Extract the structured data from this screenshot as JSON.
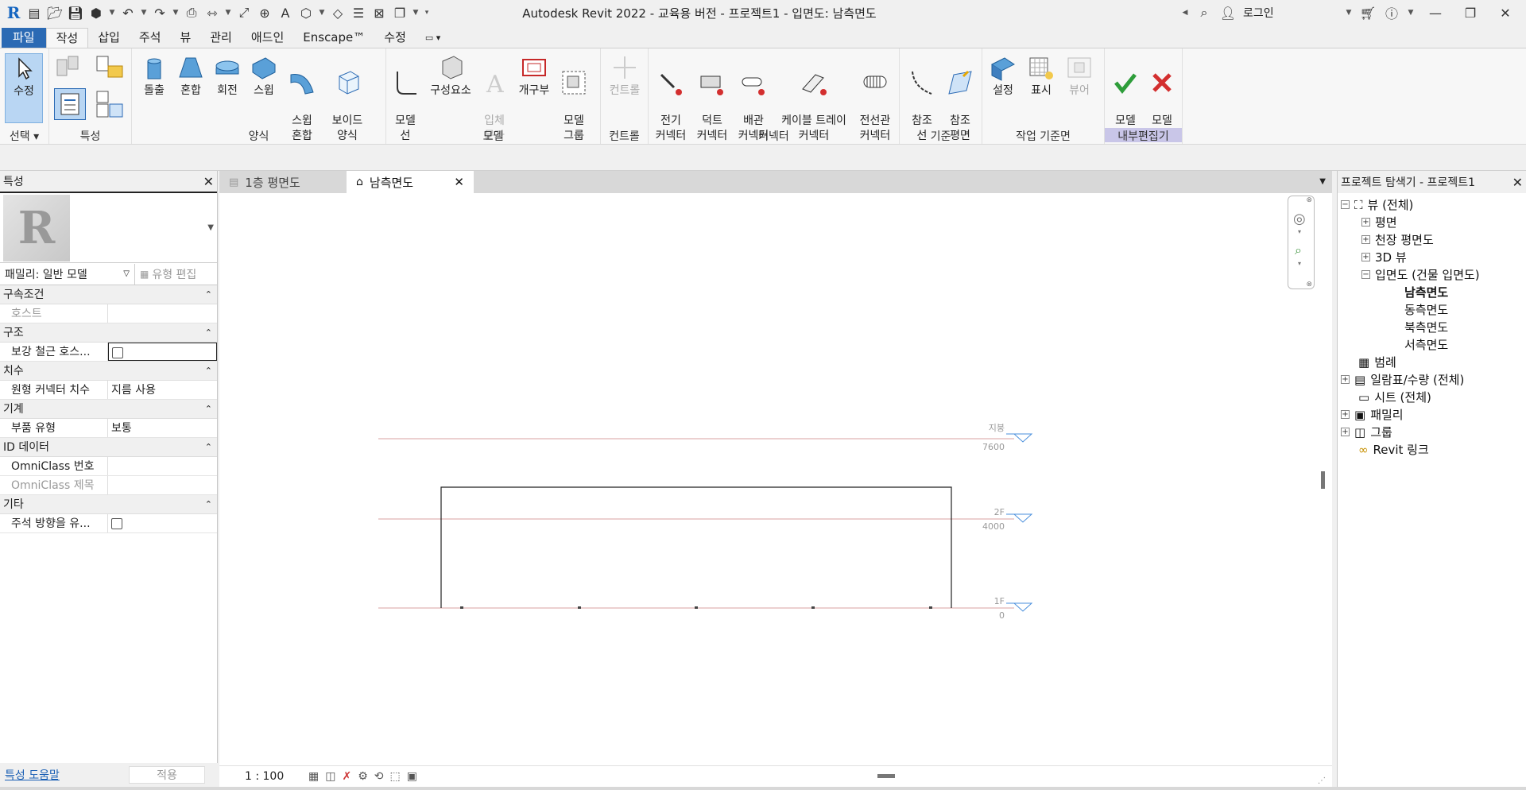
{
  "title": "Autodesk Revit 2022 - 교육용 버전 - 프로젝트1 - 입면도: 남측면도",
  "login": "로그인",
  "tabs": [
    "파일",
    "작성",
    "삽입",
    "주석",
    "뷰",
    "관리",
    "애드인",
    "Enscape™",
    "수정"
  ],
  "active_tab": "작성",
  "ribbon": {
    "select": {
      "button": "수정",
      "label": "선택"
    },
    "properties_label": "특성",
    "form": {
      "label": "양식",
      "buttons": [
        "돌출",
        "혼합",
        "회전",
        "스윕",
        "스윕\n혼합",
        "보이드\n양식"
      ]
    },
    "model": {
      "label": "모델",
      "buttons": [
        "모델\n선",
        "구성요소",
        "입체\n문자",
        "개구부",
        "모델\n그룹"
      ]
    },
    "control": {
      "label": "컨트롤",
      "buttons": [
        "컨트롤"
      ]
    },
    "connector": {
      "label": "커넥터",
      "buttons": [
        "전기\n커넥터",
        "덕트\n커넥터",
        "배관\n커넥터",
        "케이블 트레이\n커넥터",
        "전선관\n커넥터"
      ]
    },
    "datum": {
      "label": "기준",
      "buttons": [
        "참조\n선",
        "참조\n평면"
      ]
    },
    "workplane": {
      "label": "작업 기준면",
      "buttons": [
        "설정",
        "표시",
        "뷰어"
      ]
    },
    "inplace": {
      "label": "내부편집기",
      "buttons": [
        "모델\n완료",
        "모델\n취소"
      ]
    }
  },
  "properties": {
    "title": "특성",
    "family": "패밀리: 일반 모델",
    "edit_type": "유형 편집",
    "groups": [
      {
        "name": "구속조건",
        "rows": [
          {
            "k": "호스트",
            "v": "",
            "muted": true
          }
        ]
      },
      {
        "name": "구조",
        "rows": [
          {
            "k": "보강 철근 호스...",
            "v": "checkbox"
          }
        ]
      },
      {
        "name": "치수",
        "rows": [
          {
            "k": "원형 커넥터 치수",
            "v": "지름 사용"
          }
        ]
      },
      {
        "name": "기계",
        "rows": [
          {
            "k": "부품 유형",
            "v": "보통"
          }
        ]
      },
      {
        "name": "ID 데이터",
        "rows": [
          {
            "k": "OmniClass 번호",
            "v": ""
          },
          {
            "k": "OmniClass 제목",
            "v": "",
            "muted": true
          }
        ]
      },
      {
        "name": "기타",
        "rows": [
          {
            "k": "주석 방향을 유...",
            "v": "checkbox"
          }
        ]
      }
    ],
    "help_link": "특성 도움말",
    "apply": "적용"
  },
  "view_tabs": [
    {
      "label": "1층 평면도",
      "active": false
    },
    {
      "label": "남측면도",
      "active": true
    }
  ],
  "levels": [
    {
      "name": "지붕",
      "elev": "7600"
    },
    {
      "name": "2F",
      "elev": "4000"
    },
    {
      "name": "1F",
      "elev": "0"
    }
  ],
  "scale": "1 : 100",
  "browser": {
    "title": "프로젝트 탐색기 - 프로젝트1",
    "nodes": {
      "views": "뷰 (전체)",
      "plans": "평면",
      "ceiling": "천장 평면도",
      "threed": "3D 뷰",
      "elevations": "입면도 (건물 입면도)",
      "south": "남측면도",
      "east": "동측면도",
      "north": "북측면도",
      "west": "서측면도",
      "legend": "범례",
      "schedules": "일람표/수량 (전체)",
      "sheets": "시트 (전체)",
      "families": "패밀리",
      "groups": "그룹",
      "links": "Revit 링크"
    }
  }
}
